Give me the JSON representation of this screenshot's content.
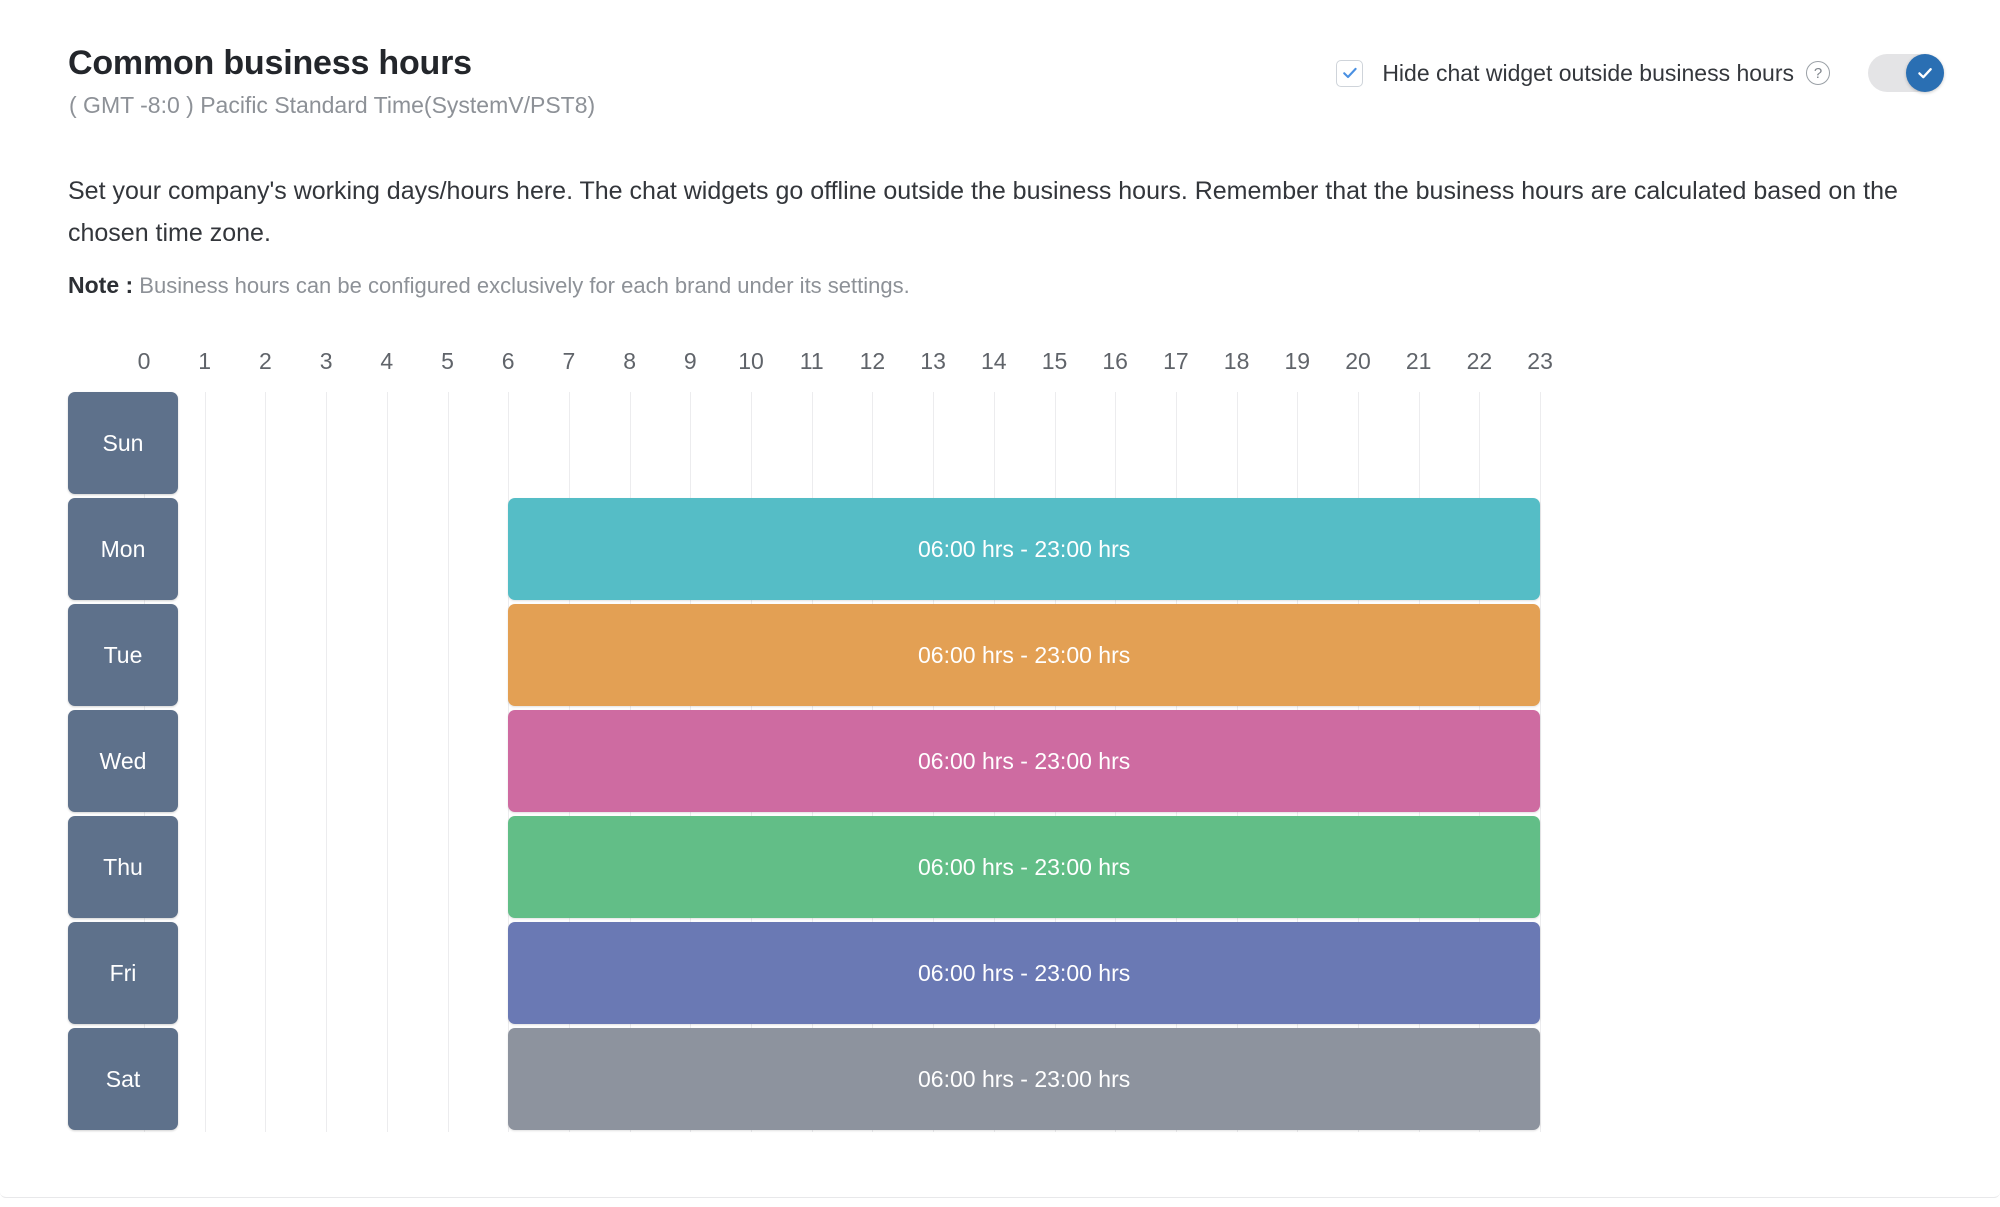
{
  "header": {
    "title": "Common business hours",
    "timezone": "( GMT -8:0 ) Pacific Standard Time(SystemV/PST8)",
    "hide_widget_label": "Hide chat widget outside business hours",
    "hide_widget_checked": true,
    "help_icon": "question-mark-circle-icon",
    "toggle_on": true,
    "toggle_icon": "check-icon"
  },
  "body": {
    "description": "Set your company's working days/hours here. The chat widgets go offline outside the business hours. Remember that the business hours are calculated based on the chosen time zone.",
    "note_label": "Note :",
    "note_text": "Business hours can be configured exclusively for each brand under its settings."
  },
  "colors": {
    "day_chip": "#5e718b",
    "toggle_track": "#e4e4e6",
    "toggle_knob": "#2a6fb3",
    "checkbox_check": "#4a90e2",
    "gridline": "#ececee",
    "title_text": "#23262b",
    "muted_text": "#8d9197"
  },
  "chart_data": {
    "type": "bar",
    "title": "Common business hours",
    "xlabel": "",
    "ylabel": "",
    "orientation": "horizontal",
    "xlim": [
      0,
      23
    ],
    "grid": true,
    "legend": "none",
    "x_tick_labels": [
      "0",
      "1",
      "2",
      "3",
      "4",
      "5",
      "6",
      "7",
      "8",
      "9",
      "10",
      "11",
      "12",
      "13",
      "14",
      "15",
      "16",
      "17",
      "18",
      "19",
      "20",
      "21",
      "22",
      "23"
    ],
    "categories": [
      "Sun",
      "Mon",
      "Tue",
      "Wed",
      "Thu",
      "Fri",
      "Sat"
    ],
    "series": [
      {
        "name": "Business hours",
        "bars": [
          {
            "day": "Sun",
            "start": null,
            "end": null,
            "label": "",
            "color": "",
            "enabled": false
          },
          {
            "day": "Mon",
            "start": 6,
            "end": 23,
            "label": "06:00 hrs - 23:00 hrs",
            "color": "#55bdc6",
            "enabled": true
          },
          {
            "day": "Tue",
            "start": 6,
            "end": 23,
            "label": "06:00 hrs - 23:00 hrs",
            "color": "#e3a054",
            "enabled": true
          },
          {
            "day": "Wed",
            "start": 6,
            "end": 23,
            "label": "06:00 hrs - 23:00 hrs",
            "color": "#ce6ba1",
            "enabled": true
          },
          {
            "day": "Thu",
            "start": 6,
            "end": 23,
            "label": "06:00 hrs - 23:00 hrs",
            "color": "#62be87",
            "enabled": true
          },
          {
            "day": "Fri",
            "start": 6,
            "end": 23,
            "label": "06:00 hrs - 23:00 hrs",
            "color": "#6a79b4",
            "enabled": true
          },
          {
            "day": "Sat",
            "start": 6,
            "end": 23,
            "label": "06:00 hrs - 23:00 hrs",
            "color": "#8d939e",
            "enabled": true
          }
        ]
      }
    ]
  }
}
